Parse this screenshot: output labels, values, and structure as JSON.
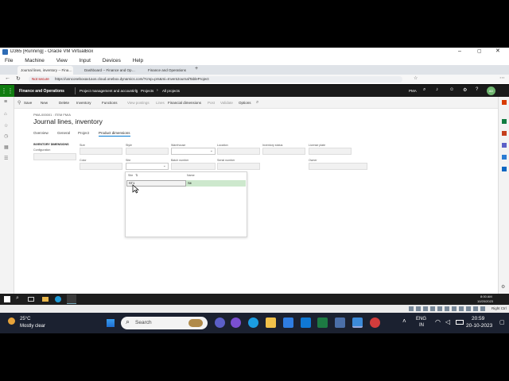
{
  "vbox": {
    "title": "D365 [Running] - Oracle VM VirtualBox",
    "menu": [
      "File",
      "Machine",
      "View",
      "Input",
      "Devices",
      "Help"
    ],
    "status": "Right Ctrl"
  },
  "browser": {
    "tabs": [
      "Journal lines, inventory -- Finan...",
      "Dashboard -- Finance and Opera...",
      "Finance and Operations"
    ],
    "security": "Not secure",
    "url": "https://usnconeboxax1aos.cloud.onebox.dynamics.com/?cmp=prs&mi=InventJournalTableProject"
  },
  "app": {
    "brand": "Finance and Operations",
    "breadcrumb": [
      "Project management and accounting",
      "Projects",
      "All projects"
    ],
    "company": "PMA",
    "user": "AD"
  },
  "actions": [
    "Save",
    "New",
    "Delete",
    "Inventory",
    "Functions",
    "View postings",
    "Lines",
    "Financial dimensions",
    "Post",
    "Validate",
    "Options"
  ],
  "page": {
    "crumb": "PMA-000001 : ITEM FM/A",
    "title": "Journal lines, inventory",
    "tabs": [
      "Overview",
      "General",
      "Project",
      "Product dimensions"
    ],
    "section": "INVENTORY DIMENSIONS",
    "labels": {
      "config": "Configuration",
      "size": "Size",
      "style": "Style",
      "warehouse": "Warehouse",
      "location": "Location",
      "inv_status": "Inventory status",
      "license": "License plate",
      "color": "Color",
      "site": "Site",
      "batch": "Batch number",
      "serial": "Serial number",
      "owner": "Owner"
    }
  },
  "lookup": {
    "col1": "Site",
    "col2": "Name",
    "row_site": "ST1",
    "row_name": "Sit"
  },
  "guest_clock": {
    "time": "8:00 AM",
    "date": "10/20/2023"
  },
  "host": {
    "temp": "25°C",
    "weather": "Mostly clear",
    "search": "Search",
    "lang1": "ENG",
    "lang2": "IN",
    "time": "20:59",
    "date": "20-10-2023"
  }
}
